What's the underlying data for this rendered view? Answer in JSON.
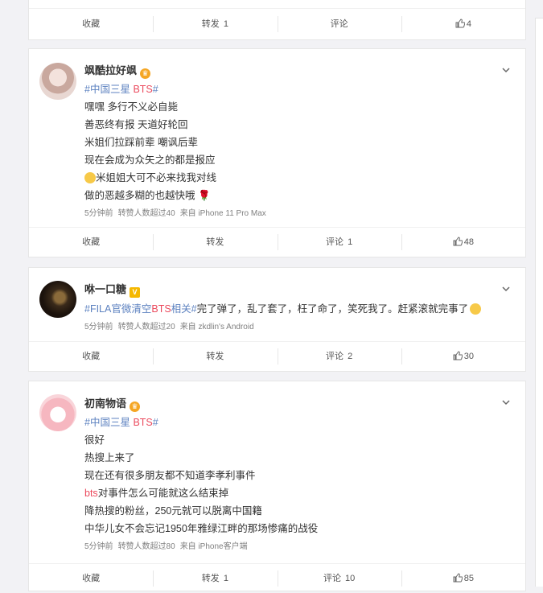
{
  "post0": {
    "actions": {
      "fav": "收藏",
      "repost": "转发",
      "repost_count": "1",
      "comment": "评论",
      "like_count": "4"
    }
  },
  "post1": {
    "username": "飒酷拉好飒",
    "lines": [
      "#中国三星 BTS#",
      "嘿嘿 多行不义必自毙",
      "善恶终有报 天道好轮回",
      "米姐们拉踩前辈 嘲讽后辈",
      "现在会成为众矢之的都是报应",
      "米姐姐大可不必来找我对线",
      "做的恶越多糊的也越快哦"
    ],
    "meta": {
      "time": "5分钟前",
      "reposts": "转赞人数超过40",
      "source": "来自 iPhone 11 Pro Max"
    },
    "actions": {
      "fav": "收藏",
      "repost": "转发",
      "comment": "评论",
      "comment_count": "1",
      "like_count": "48"
    }
  },
  "post2": {
    "username": "咻一口糖",
    "topic": "#FILA官微清空BTS相关#",
    "text": "完了弹了，乱了套了，枉了命了，笑死我了。赶紧滚就完事了",
    "meta": {
      "time": "5分钟前",
      "reposts": "转赞人数超过20",
      "source": "来自 zkdlin's Android"
    },
    "actions": {
      "fav": "收藏",
      "repost": "转发",
      "comment": "评论",
      "comment_count": "2",
      "like_count": "30"
    }
  },
  "post3": {
    "username": "初南物语",
    "lines": [
      "#中国三星 BTS#",
      "很好",
      "热搜上来了",
      "现在还有很多朋友都不知道李孝利事件",
      "bts对事件怎么可能就这么结束掉",
      "降热搜的粉丝，250元就可以脱离中国籍",
      "中华儿女不会忘记1950年雅绿江畔的那场惨痛的战役"
    ],
    "meta": {
      "time": "5分钟前",
      "reposts": "转赞人数超过80",
      "source": "来自 iPhone客户端"
    },
    "actions": {
      "fav": "收藏",
      "repost": "转发",
      "repost_count": "1",
      "comment": "评论",
      "comment_count": "10",
      "like_count": "85"
    }
  }
}
